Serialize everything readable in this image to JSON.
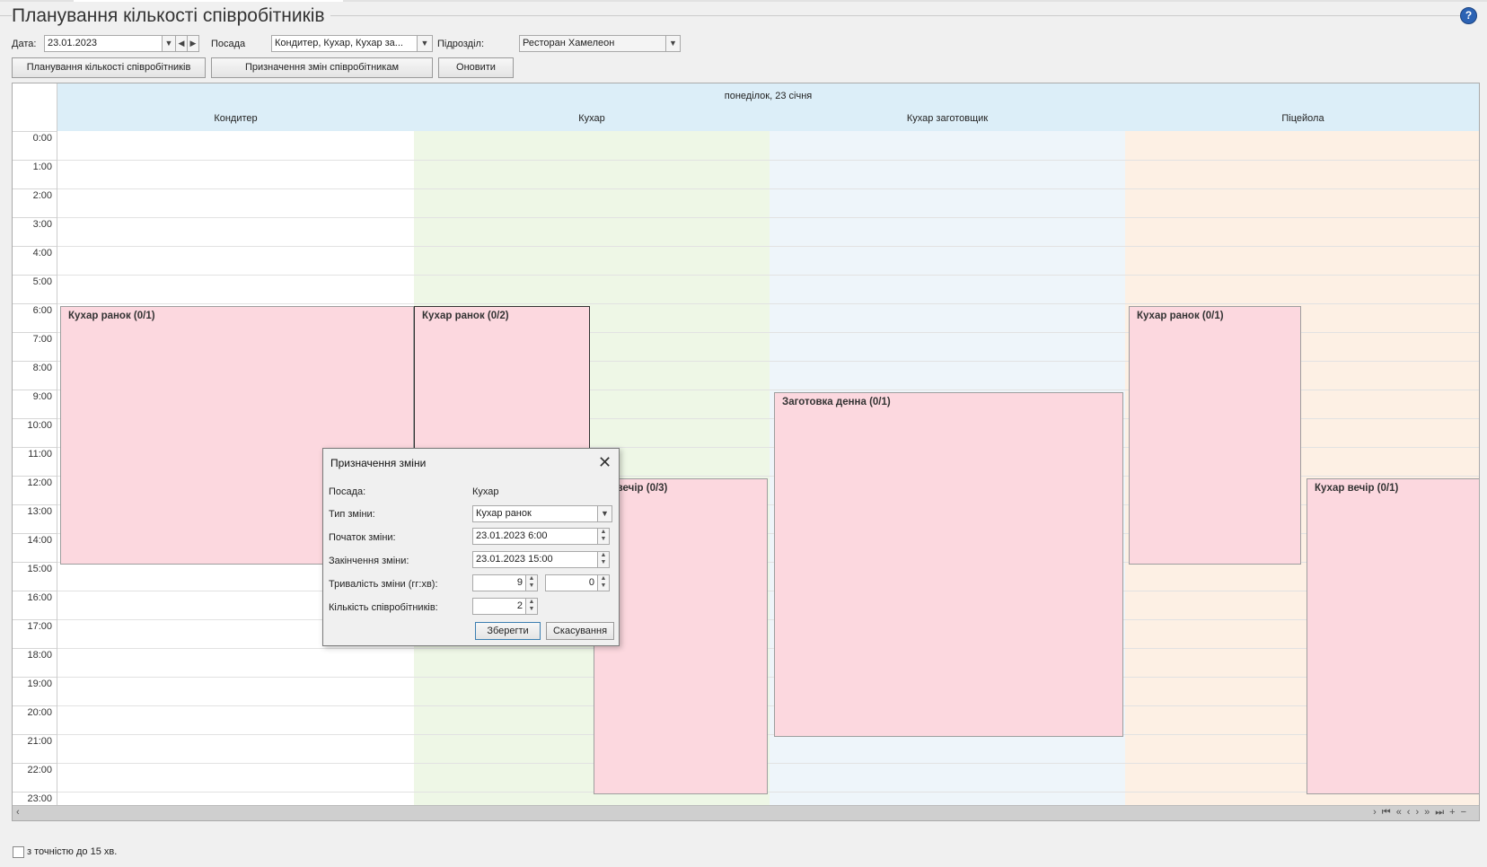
{
  "page": {
    "title": "Планування кількості співробітників",
    "help": "?"
  },
  "filters": {
    "date_label": "Дата:",
    "date_value": "23.01.2023",
    "position_label": "Посада",
    "position_value": "Кондитер, Кухар, Кухар за...",
    "department_label": "Підрозділ:",
    "department_value": "Ресторан Хамелеон"
  },
  "buttons": {
    "planning": "Планування кількості співробітників",
    "assign": "Призначення змін співробітникам",
    "refresh": "Оновити"
  },
  "grid": {
    "day": "понеділок, 23 січня",
    "columns": [
      "Кондитер",
      "Кухар",
      "Кухар заготовщик",
      "Піцейола"
    ],
    "lane_colors": [
      "#ffffff",
      "#eef7e6",
      "#eef5fa",
      "#fdf0e4"
    ],
    "hours": [
      "0:00",
      "1:00",
      "2:00",
      "3:00",
      "4:00",
      "5:00",
      "6:00",
      "7:00",
      "8:00",
      "9:00",
      "10:00",
      "11:00",
      "12:00",
      "13:00",
      "14:00",
      "15:00",
      "16:00",
      "17:00",
      "18:00",
      "19:00",
      "20:00",
      "21:00",
      "22:00",
      "23:00"
    ],
    "shifts": {
      "s1": "Кухар ранок (0/1)",
      "s2": "Кухар ранок (0/2)",
      "s3": "ар вечір (0/3)",
      "s4": "Заготовка денна (0/1)",
      "s5": "Кухар ранок (0/1)",
      "s6": "Кухар вечір (0/1)"
    }
  },
  "dialog": {
    "title": "Призначення зміни",
    "position_label": "Посада:",
    "position_value": "Кухар",
    "shift_type_label": "Тип зміни:",
    "shift_type_value": "Кухар ранок",
    "start_label": "Початок зміни:",
    "start_value": "23.01.2023 6:00",
    "end_label": "Закінчення зміни:",
    "end_value": "23.01.2023 15:00",
    "duration_label": "Тривалість зміни (гг:хв):",
    "duration_hours": "9",
    "duration_minutes": "0",
    "count_label": "Кількість співробітників:",
    "count_value": "2",
    "save": "Зберегти",
    "cancel": "Скасування"
  },
  "footer": {
    "checkbox_label": "з точністю до 15 хв."
  }
}
